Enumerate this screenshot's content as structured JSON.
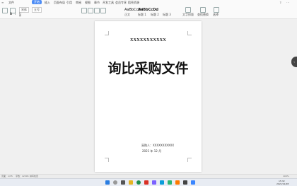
{
  "ribbon": {
    "menu_tabs": [
      "文件",
      "开始",
      "插入",
      "页面布局",
      "引用",
      "审阅",
      "视图",
      "章节",
      "开发工具",
      "会员专享",
      "稻壳资源"
    ],
    "active_tab": "开始",
    "font_name": "宋体",
    "font_size": "五号",
    "style_preview": "AaBbCcDd",
    "style_labels": [
      "正文",
      "标题 1",
      "标题 2",
      "标题 3"
    ],
    "tool_labels": [
      "文字排版",
      "查找替换",
      "选择"
    ],
    "format_buttons": [
      "B",
      "I",
      "U"
    ]
  },
  "document": {
    "code": "XXXXXXXXXXX",
    "title": "询比采购文件",
    "buyer_label": "采购人：XXXXXXXXXXX",
    "date": "2021 年 12 月"
  },
  "statusbar": {
    "page": "页面：1/35",
    "words": "字数：12345",
    "spellcheck": "拼写检查",
    "zoom": "100%"
  },
  "taskbar": {
    "time": "15:32",
    "date": "2021/12/28"
  },
  "colors": {
    "accent": "#4e8df5",
    "ribbon_bg": "#fafafa",
    "workspace_bg": "#f0f0f0"
  }
}
